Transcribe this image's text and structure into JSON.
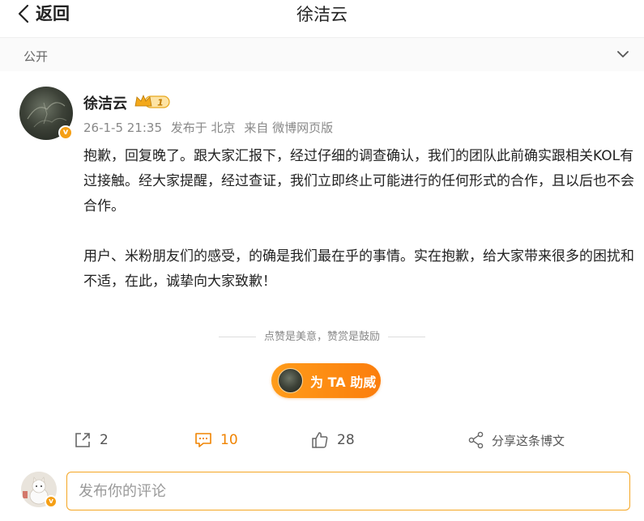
{
  "header": {
    "back_label": "返回",
    "title": "徐洁云"
  },
  "visibility": {
    "label": "公开"
  },
  "post": {
    "author": "徐洁云",
    "badge_level": "1",
    "verified_mark": "v",
    "meta": {
      "time": "26-1-5 21:35",
      "location": "发布于 北京",
      "source": "来自 微博网页版"
    },
    "paragraphs": [
      "抱歉，回复晚了。跟大家汇报下，经过仔细的调查确认，我们的团队此前确实跟相关KOL有过接触。经大家提醒，经过查证，我们立即终止可能进行的任何形式的合作，且以后也不会合作。",
      "用户、米粉朋友们的感受，的确是我们最在乎的事情。实在抱歉，给大家带来很多的困扰和不适，在此，诚挚向大家致歉！"
    ]
  },
  "encourage": {
    "text": "点赞是美意，赞赏是鼓励",
    "button_label": "为 TA 助威"
  },
  "actions": {
    "repost_count": "2",
    "comment_count": "10",
    "like_count": "28",
    "share_label": "分享这条博文"
  },
  "composer": {
    "placeholder": "发布你的评论",
    "verified_mark": "v"
  },
  "colors": {
    "accent": "#f08300",
    "button_gradient_start": "#ff9c1a",
    "input_border": "#f5a623"
  }
}
